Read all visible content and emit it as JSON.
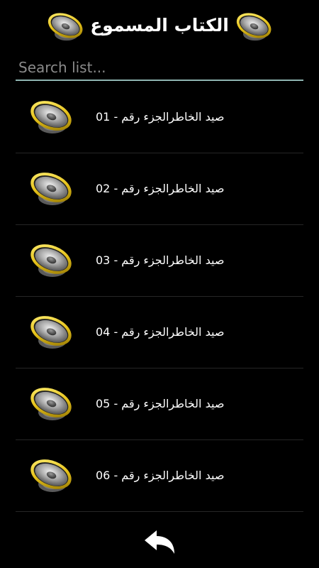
{
  "header": {
    "title": "الكتاب المسموع",
    "left_icon": "speaker-icon",
    "right_icon": "speaker-icon"
  },
  "search": {
    "placeholder": "Search list...",
    "value": ""
  },
  "tracks": [
    {
      "label": "صيد الخاطرالجزء رقم - 01",
      "icon": "speaker-icon"
    },
    {
      "label": "صيد الخاطرالجزء رقم - 02",
      "icon": "speaker-icon"
    },
    {
      "label": "صيد الخاطرالجزء رقم - 03",
      "icon": "speaker-icon"
    },
    {
      "label": "صيد الخاطرالجزء رقم - 04",
      "icon": "speaker-icon"
    },
    {
      "label": "صيد الخاطرالجزء رقم - 05",
      "icon": "speaker-icon"
    },
    {
      "label": "صيد الخاطرالجزء رقم - 06",
      "icon": "speaker-icon"
    }
  ],
  "footer": {
    "back_icon": "back-arrow-icon"
  },
  "colors": {
    "background": "#000000",
    "text": "#ffffff",
    "search_underline": "#8fb5b2",
    "speaker_rim": "#e6c21a",
    "divider": "#262626"
  }
}
